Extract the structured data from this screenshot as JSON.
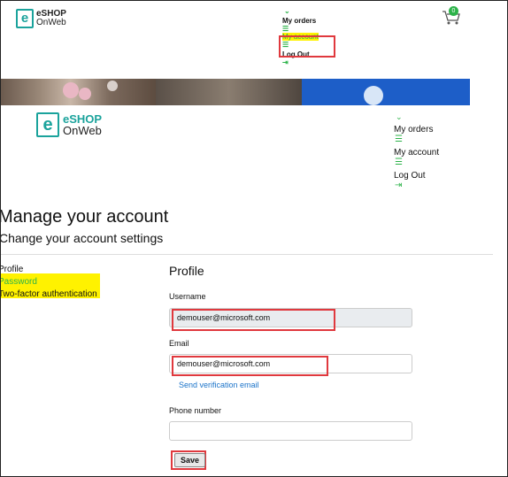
{
  "brand": {
    "line1": "eSHOP",
    "line2": "OnWeb",
    "mark": "e"
  },
  "mini_nav": {
    "chevron": "⌄",
    "orders": "My orders",
    "account": "My account",
    "logout": "Log Out"
  },
  "cart": {
    "count": "0",
    "icon": "cart-icon"
  },
  "nav": {
    "chevron": "⌄",
    "orders": "My orders",
    "account": "My account",
    "logout": "Log Out"
  },
  "page": {
    "title": "Manage your account",
    "subtitle": "Change your account settings"
  },
  "sidebar": {
    "items": [
      {
        "label": "Profile"
      },
      {
        "label": "Password"
      },
      {
        "label": "Two-factor authentication"
      }
    ]
  },
  "profile": {
    "heading": "Profile",
    "username_label": "Username",
    "username_value": "demouser@microsoft.com",
    "email_label": "Email",
    "email_value": "demouser@microsoft.com",
    "verify_link": "Send verification email",
    "phone_label": "Phone number",
    "phone_value": "",
    "save_label": "Save"
  },
  "colors": {
    "accent": "#2db34a",
    "brand": "#1ba39c",
    "highlight": "#fff200",
    "annotation": "#e0393e",
    "link": "#1a73c9"
  }
}
